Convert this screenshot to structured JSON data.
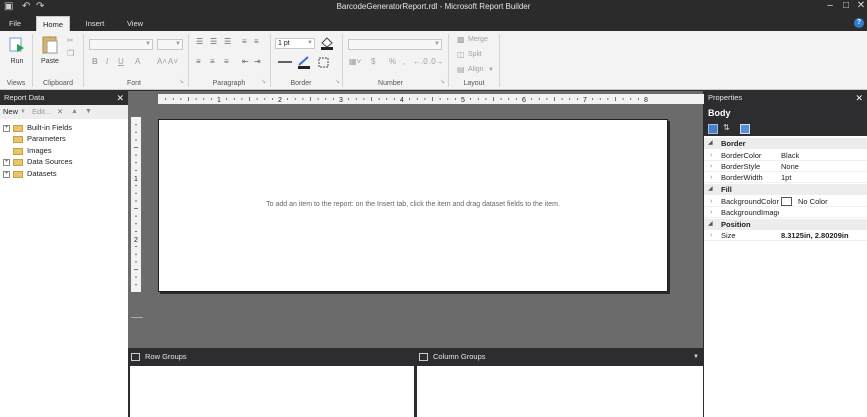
{
  "app": {
    "title": "BarcodeGeneratorReport.rdl - Microsoft Report Builder",
    "help_label": "?"
  },
  "tabs": [
    "File",
    "Home",
    "Insert",
    "View"
  ],
  "ribbon": {
    "run_label": "Run",
    "paste_label": "Paste",
    "groups": {
      "views": "Views",
      "clipboard": "Clipboard",
      "font": "Font",
      "paragraph": "Paragraph",
      "border": "Border",
      "number": "Number",
      "layout": "Layout"
    },
    "border_width_value": "1 pt",
    "merge_label": "Merge",
    "split_label": "Split",
    "align_label": "Align"
  },
  "report_data": {
    "title": "Report Data",
    "new_label": "New",
    "edit_label": "Edit...",
    "items": [
      {
        "label": "Built-in Fields",
        "expandable": true
      },
      {
        "label": "Parameters",
        "expandable": false
      },
      {
        "label": "Images",
        "expandable": false
      },
      {
        "label": "Data Sources",
        "expandable": true
      },
      {
        "label": "Datasets",
        "expandable": true
      }
    ]
  },
  "ruler": {
    "numbers": [
      "1",
      "2",
      "3",
      "4",
      "5",
      "6",
      "7",
      "8"
    ],
    "v_numbers": [
      "1",
      "2"
    ]
  },
  "design": {
    "hint": "To add an item to the report: on the Insert tab, click the item and drag dataset fields to the item."
  },
  "groups": {
    "row_label": "Row Groups",
    "column_label": "Column Groups"
  },
  "properties": {
    "title": "Properties",
    "selected": "Body",
    "categories": [
      {
        "name": "Border",
        "rows": [
          {
            "name": "BorderColor",
            "value": "Black"
          },
          {
            "name": "BorderStyle",
            "value": "None"
          },
          {
            "name": "BorderWidth",
            "value": "1pt"
          }
        ]
      },
      {
        "name": "Fill",
        "rows": [
          {
            "name": "BackgroundColor",
            "value": "No Color"
          },
          {
            "name": "BackgroundImage",
            "value": ""
          }
        ]
      },
      {
        "name": "Position",
        "rows": [
          {
            "name": "Size",
            "value": "8.3125in, 2.80209in"
          }
        ]
      }
    ]
  },
  "colors": {
    "dark_chrome": "#2d2d30",
    "ribbon": "#f3f3f3",
    "canvas": "#6b6b6b",
    "help_accent": "#2f7bd6"
  }
}
